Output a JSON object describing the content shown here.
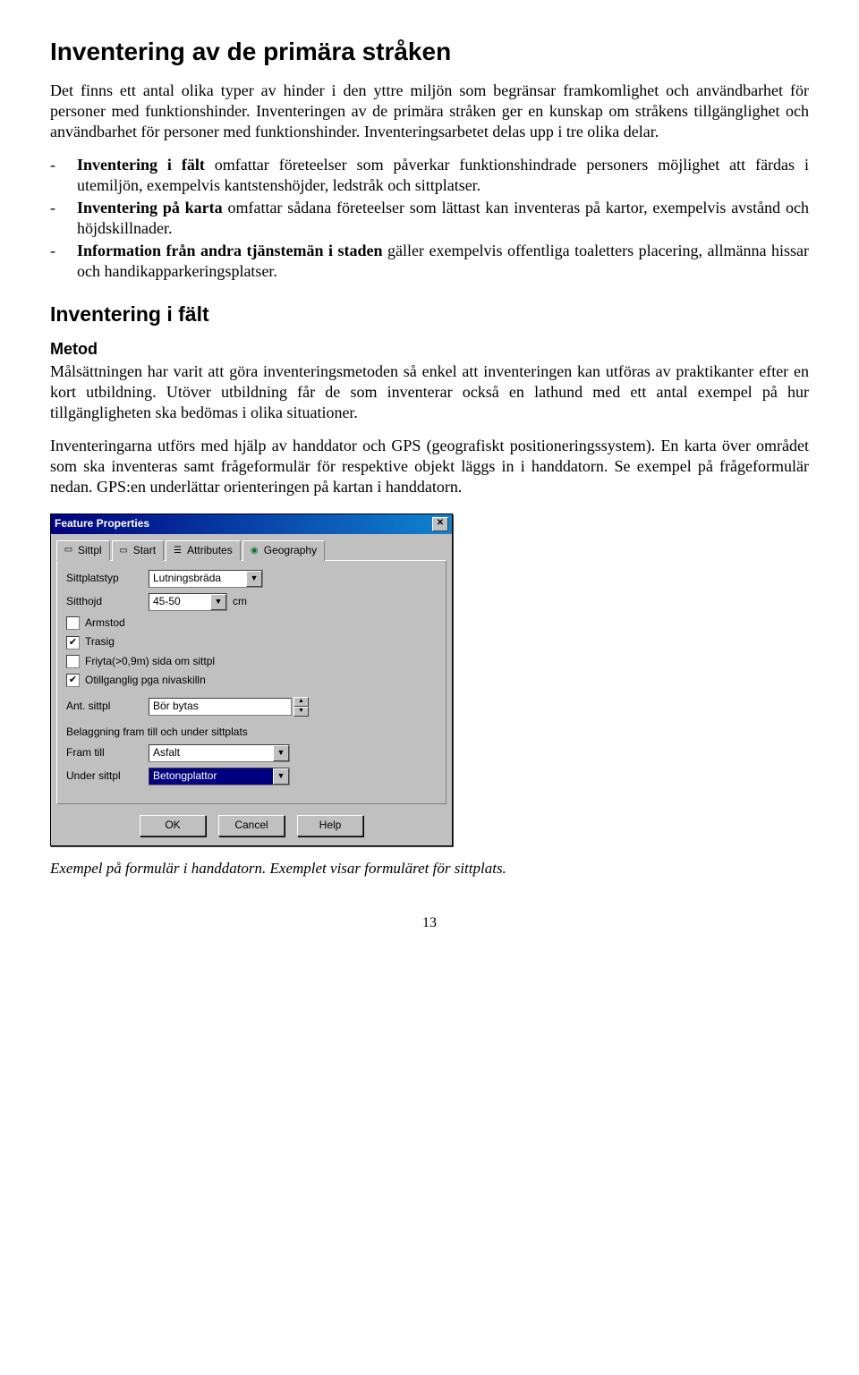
{
  "heading1": "Inventering av de primära stråken",
  "para1": "Det finns ett antal olika typer av hinder i den yttre miljön som begränsar framkomlighet och användbarhet för personer med funktionshinder. Inventeringen av de primära stråken ger en kunskap om stråkens tillgänglighet och användbarhet för personer med funktionshinder. Inventeringsarbetet delas upp i tre olika delar.",
  "bullets": [
    {
      "bold": "Inventering i fält",
      "rest": " omfattar företeelser som påverkar funktionshindrade personers möjlighet att färdas i utemiljön, exempelvis kantstenshöjder, ledstråk och sittplatser."
    },
    {
      "bold": "Inventering på karta",
      "rest": " omfattar sådana företeelser som lättast kan inventeras på kartor, exempelvis avstånd och höjdskillnader."
    },
    {
      "bold": "Information från andra tjänstemän i staden",
      "rest": " gäller exempelvis offentliga toaletters placering, allmänna hissar och handikapparkeringsplatser."
    }
  ],
  "heading2": "Inventering i fält",
  "heading3": "Metod",
  "para2": "Målsättningen har varit att göra inventeringsmetoden så enkel att inventeringen kan utföras av praktikanter efter en kort utbildning. Utöver utbildning får de som inventerar också en lathund med ett antal exempel på hur tillgängligheten ska bedömas i olika situationer.",
  "para3": "Inventeringarna utförs med hjälp av handdator och GPS (geografiskt positioneringssystem). En karta över området som ska inventeras samt frågeformulär för respektive objekt läggs in i handdatorn. Se exempel på frågeformulär nedan. GPS:en underlättar orienteringen på kartan i handdatorn.",
  "dialog": {
    "title": "Feature Properties",
    "tabs": [
      "Sittpl",
      "Start",
      "Attributes",
      "Geography"
    ],
    "fields": {
      "sittplatstyp_label": "Sittplatstyp",
      "sittplatstyp_value": "Lutningsbräda",
      "sitthojd_label": "Sitthojd",
      "sitthojd_value": "45-50",
      "sitthojd_unit": "cm",
      "armstod_label": "Armstod",
      "armstod_checked": false,
      "trasig_label": "Trasig",
      "trasig_checked": true,
      "friyta_label": "Friyta(>0,9m) sida om sittpl",
      "friyta_checked": false,
      "otillganglig_label": "Otillganglig pga nivaskilln",
      "otillganglig_checked": true,
      "ant_label": "Ant. sittpl",
      "ant_value": "Bör bytas",
      "belaggning_label": "Belaggning fram till och under sittplats",
      "framtill_label": "Fram till",
      "framtill_value": "Asfalt",
      "under_label": "Under sittpl",
      "under_value": "Betongplattor"
    },
    "buttons": {
      "ok": "OK",
      "cancel": "Cancel",
      "help": "Help"
    }
  },
  "caption": "Exempel på formulär i handdatorn. Exemplet visar formuläret för sittplats.",
  "pagenum": "13"
}
